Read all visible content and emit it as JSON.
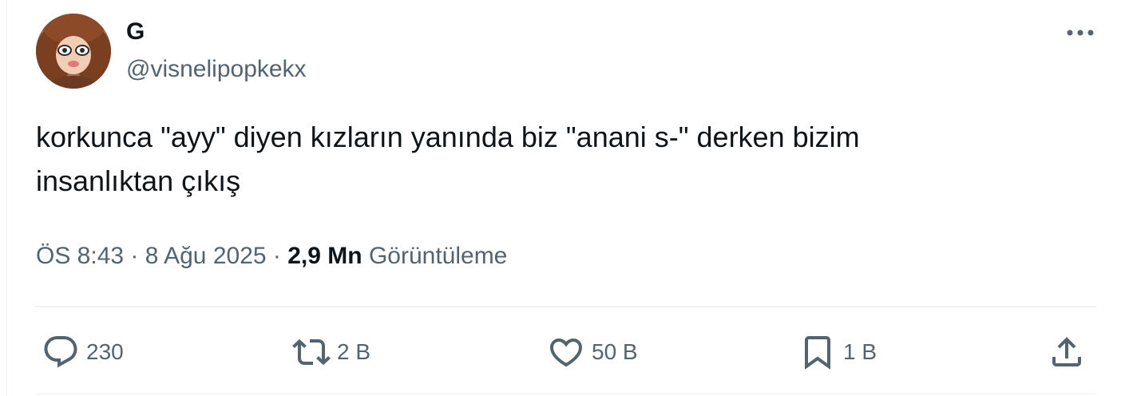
{
  "author": {
    "display_name": "G",
    "handle": "@visnelipopkekx",
    "avatar_icon": "profile-avatar"
  },
  "tweet": {
    "text": "korkunca \"ayy\" diyen kızların yanında biz \"anani s-\" derken bizim\ninsanlıktan çıkış"
  },
  "meta": {
    "time": "ÖS 8:43",
    "separator_1": " · ",
    "date": "8 Ağu 2025",
    "separator_2": " · ",
    "views_count": "2,9 Mn",
    "views_label": " Görüntüleme"
  },
  "actions": {
    "reply": {
      "icon": "reply-icon",
      "count": "230"
    },
    "retweet": {
      "icon": "retweet-icon",
      "count": "2 B"
    },
    "like": {
      "icon": "heart-icon",
      "count": "50 B"
    },
    "bookmark": {
      "icon": "bookmark-icon",
      "count": "1 B"
    },
    "share": {
      "icon": "share-icon"
    }
  },
  "more": {
    "icon": "more-icon"
  },
  "colors": {
    "text_primary": "#0f1419",
    "text_secondary": "#536471",
    "divider": "#eff3f4",
    "background": "#ffffff"
  }
}
